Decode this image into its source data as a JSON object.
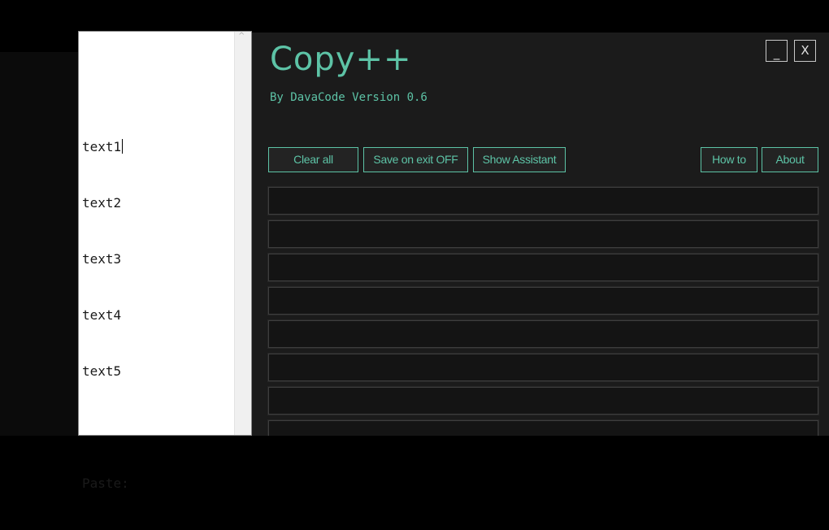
{
  "editor": {
    "lines": [
      "text1",
      "text2",
      "text3",
      "text4",
      "text5",
      "",
      "Paste:"
    ],
    "scroll_up_glyph": "^"
  },
  "app": {
    "title": "Copy++",
    "subtitle": "By DavaCode Version 0.6",
    "window_controls": {
      "minimize_label": "_",
      "close_label": "X"
    },
    "toolbar": {
      "clear_all_label": "Clear all",
      "save_on_exit_label": "Save on exit OFF",
      "show_assistant_label": "Show Assistant",
      "how_to_label": "How to",
      "about_label": "About"
    },
    "clipboard_slots": [
      "",
      "",
      "",
      "",
      "",
      "",
      "",
      ""
    ]
  },
  "colors": {
    "accent": "#5dc3a6",
    "window_bg": "#1b1b1b",
    "slot_bg": "#141414",
    "editor_bg": "#ffffff"
  },
  "icons": {
    "cursor": "i-beam-cursor-icon"
  }
}
